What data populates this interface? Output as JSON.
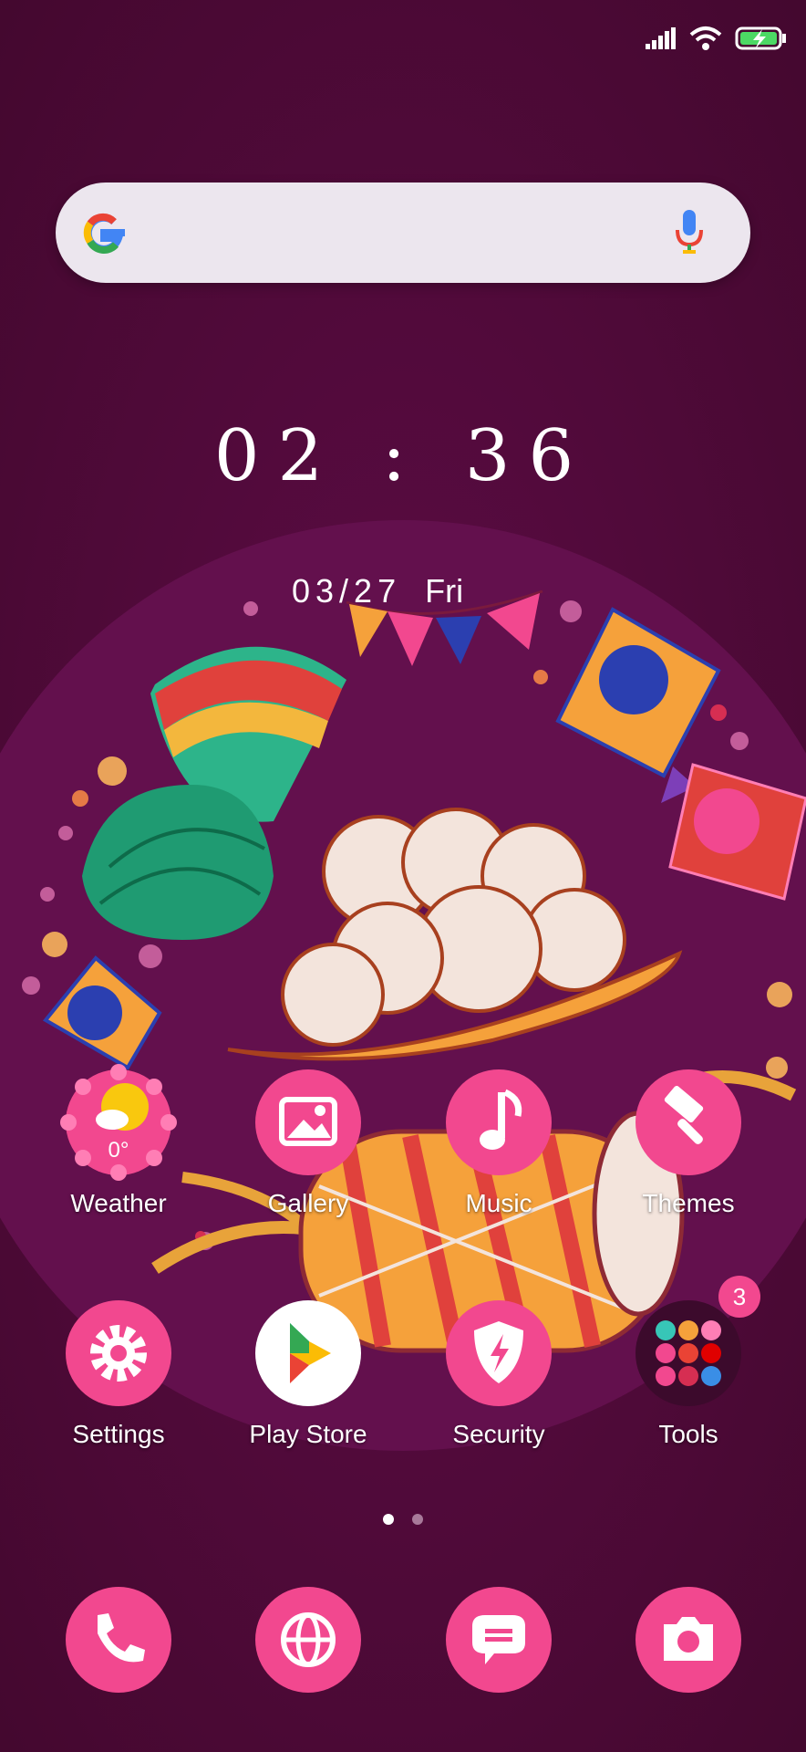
{
  "status_bar": {
    "icons": [
      "signal-icon",
      "wifi-icon",
      "battery-charging-icon"
    ]
  },
  "search_bar": {
    "logo": "google-logo",
    "mic_icon": "microphone-icon"
  },
  "clock": {
    "time": "02 : 36"
  },
  "date": {
    "date": "03/27",
    "weekday": "Fri"
  },
  "home_apps": [
    {
      "label": "Weather",
      "icon": "weather-icon",
      "temp": "0°"
    },
    {
      "label": "Gallery",
      "icon": "gallery-icon"
    },
    {
      "label": "Music",
      "icon": "music-note-icon"
    },
    {
      "label": "Themes",
      "icon": "paintbrush-icon"
    },
    {
      "label": "Settings",
      "icon": "gear-icon"
    },
    {
      "label": "Play Store",
      "icon": "play-store-icon"
    },
    {
      "label": "Security",
      "icon": "shield-bolt-icon"
    },
    {
      "label": "Tools",
      "icon": "folder-icon",
      "badge": "3"
    }
  ],
  "page_indicator": {
    "pages": 2,
    "current": 1
  },
  "dock": [
    {
      "icon": "phone-icon"
    },
    {
      "icon": "browser-globe-icon"
    },
    {
      "icon": "messages-icon"
    },
    {
      "icon": "camera-icon"
    }
  ],
  "colors": {
    "background": "#4f0a3a",
    "icon_pink": "#f2488f",
    "icon_light": "#ff7eb5"
  }
}
